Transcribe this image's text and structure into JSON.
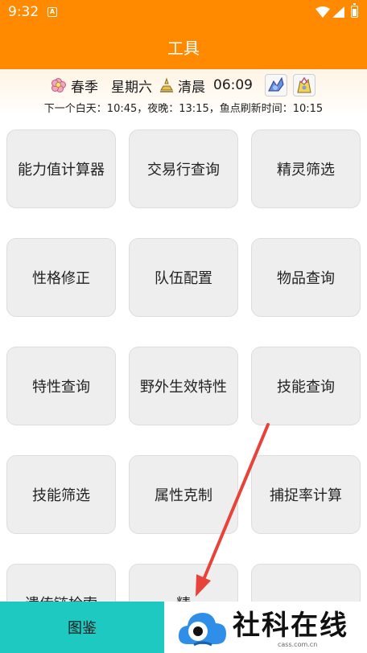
{
  "status_bar": {
    "time": "9:32",
    "app_icon_letter": "A"
  },
  "app_bar": {
    "title": "工具"
  },
  "info": {
    "season": "春季",
    "weekday": "星期六",
    "period": "清晨",
    "time": "06:09",
    "next_times": "下一个白天：10:45，夜晚：13:15，鱼点刷新时间：10:15"
  },
  "tools": [
    {
      "label": "能力值计算器"
    },
    {
      "label": "交易行查询"
    },
    {
      "label": "精灵筛选"
    },
    {
      "label": "性格修正"
    },
    {
      "label": "队伍配置"
    },
    {
      "label": "物品查询"
    },
    {
      "label": "特性查询"
    },
    {
      "label": "野外生效特性"
    },
    {
      "label": "技能查询"
    },
    {
      "label": "技能筛选"
    },
    {
      "label": "属性克制"
    },
    {
      "label": "捕捉率计算"
    },
    {
      "label": "遗传链检索"
    },
    {
      "label": "精"
    },
    {
      "label": ""
    }
  ],
  "bottom_nav": {
    "tab_label": "图鉴"
  },
  "watermark": {
    "text": "社科在线",
    "sub": "cass.com.cn"
  },
  "colors": {
    "accent": "#ff8a00",
    "nav_tab": "#1ec9c2",
    "card_bg": "#eeeeee",
    "arrow": "#e8433a"
  }
}
